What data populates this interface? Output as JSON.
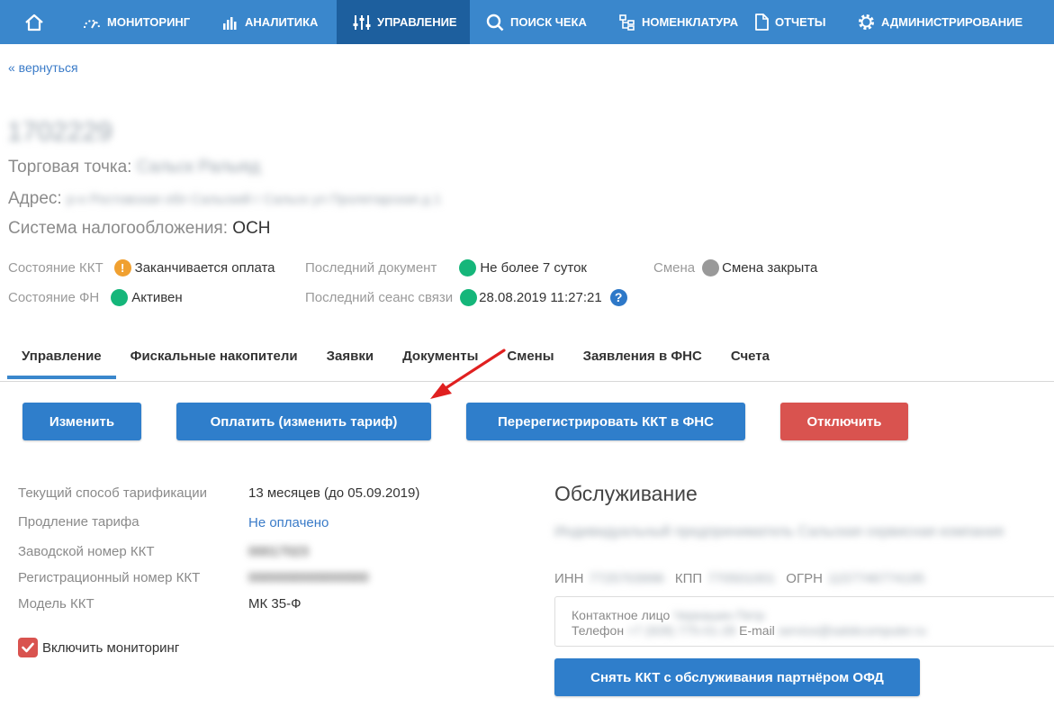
{
  "nav": {
    "items": [
      {
        "label": "МОНИТОРИНГ"
      },
      {
        "label": "АНАЛИТИКА"
      },
      {
        "label": "УПРАВЛЕНИЕ"
      },
      {
        "label": "ПОИСК ЧЕКА"
      },
      {
        "label": "НОМЕНКЛАТУРА"
      },
      {
        "label": "ОТЧЕТЫ"
      },
      {
        "label": "АДМИНИСТРИРОВАНИЕ"
      }
    ],
    "active_index": 2,
    "bar_color": "#3a87cc",
    "active_color": "#1d5f9e"
  },
  "back_link": "« вернуться",
  "kkt": {
    "number": "1702229",
    "shop_label": "Торговая точка: ",
    "shop_value": "Сальск Ралыяд",
    "address_label": "Адрес: ",
    "address_value": "р-н Ростовская обл Сальский г Сальск ул Пролетарская д 1",
    "tax_label": "Система налогообложения: ",
    "tax_value": "ОСН"
  },
  "status": {
    "kkt_label": "Состояние ККТ",
    "kkt_value": "Заканчивается оплата",
    "kkt_icon_glyph": "!",
    "fn_label": "Состояние ФН",
    "fn_value": "Активен",
    "last_doc_label": "Последний документ",
    "last_doc_value": "Не более 7 суток",
    "last_session_label": "Последний сеанс связи",
    "last_session_value": "28.08.2019 11:27:21",
    "help_glyph": "?",
    "shift_label": "Смена",
    "shift_value": "Смена закрыта",
    "colors": {
      "ok": "#15b67a",
      "warning": "#f0a030",
      "neutral": "#999999"
    }
  },
  "tabs": [
    {
      "label": "Управление"
    },
    {
      "label": "Фискальные накопители"
    },
    {
      "label": "Заявки"
    },
    {
      "label": "Документы"
    },
    {
      "label": "Смены"
    },
    {
      "label": "Заявления в ФНС"
    },
    {
      "label": "Счета"
    }
  ],
  "buttons": {
    "edit": "Изменить",
    "pay": "Оплатить (изменить тариф)",
    "reregister": "Перерегистрировать ККТ в ФНС",
    "disable": "Отключить",
    "remove_service": "Снять ККТ с обслуживания партнёром ОФД",
    "blue": "#2f7ecb",
    "red": "#d9534f"
  },
  "details": {
    "tariff_label": "Текущий способ тарификации",
    "tariff_value": "13 месяцев (до 05.09.2019)",
    "renewal_label": "Продление тарифа",
    "renewal_value": "Не оплачено",
    "serial_label": "Заводской номер ККТ",
    "serial_value": "00017023",
    "reg_label": "Регистрационный номер ККТ",
    "reg_value": "0000000000000000",
    "model_label": "Модель ККТ",
    "model_value": "МК 35-Ф",
    "monitoring_label": "Включить мониторинг"
  },
  "service": {
    "title": "Обслуживание",
    "name": "Индивидуальный предприниматель Сальская сервисная компания",
    "inn_label": "ИНН",
    "inn_value": "7725703996",
    "kpp_label": "КПП",
    "kpp_value": "770501001",
    "ogrn_label": "ОГРН",
    "ogrn_value": "1157746774195",
    "contact_label": "Контактное лицо",
    "contact_value": "Черкашин Петр",
    "phone_label": "Телефон",
    "phone_value": "+7 (928) 775-01-28",
    "email_label": "E-mail",
    "email_value": "service@salskcomputer.ru"
  }
}
